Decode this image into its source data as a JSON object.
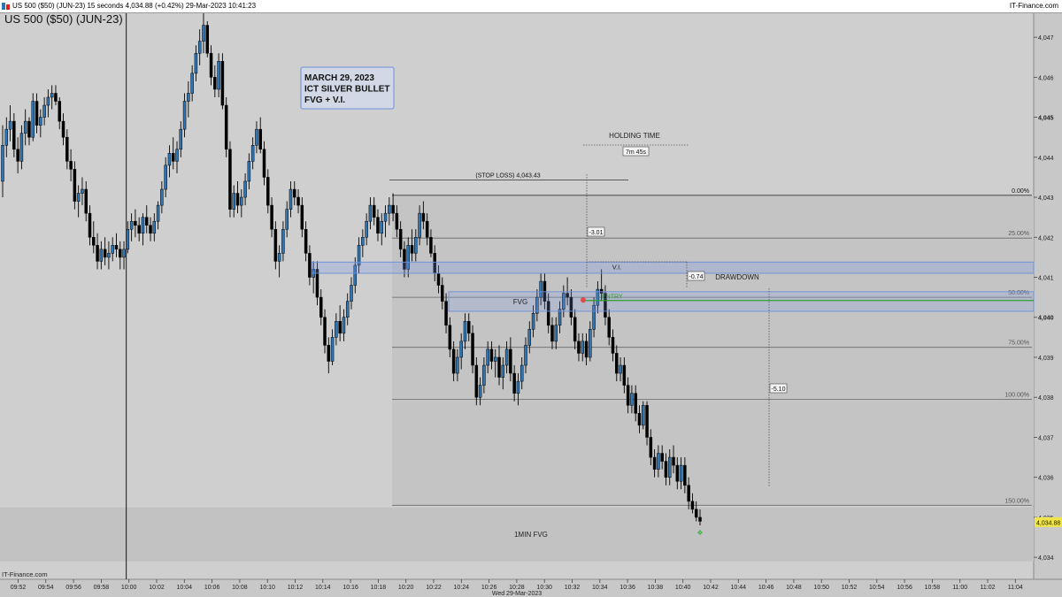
{
  "window": {
    "title": "US 500 ($50) (JUN-23) 15 seconds 4,034.88 (+0.42%) 29-Mar-2023 10:41:23",
    "brand": "IT-Finance.com"
  },
  "chart_data": {
    "type": "candlestick",
    "title": "US 500 ($50) (JUN-23)",
    "watermark": "IT-Finance.com",
    "date_label": "Wed 29-Mar-2023",
    "current_price": 4034.88,
    "current_price_label": "4,034.88",
    "colors": {
      "up": "#2e75b6",
      "down": "#000000",
      "box": "#6b8fd6",
      "entry": "#2e9e2e"
    },
    "ylim": [
      4033.45,
      4047.6
    ],
    "x_ticks": [
      "09:52",
      "09:54",
      "09:56",
      "09:58",
      "10:00",
      "10:02",
      "10:04",
      "10:06",
      "10:08",
      "10:10",
      "10:12",
      "10:14",
      "10:16",
      "10:18",
      "10:20",
      "10:22",
      "10:24",
      "10:26",
      "10:28",
      "10:30",
      "10:32",
      "10:34",
      "10:36",
      "10:38",
      "10:40",
      "10:42",
      "10:44",
      "10:46",
      "10:48",
      "10:50",
      "10:52",
      "10:54",
      "10:56",
      "10:58",
      "11:00",
      "11:02",
      "11:04"
    ],
    "y_ticks": [
      {
        "value": 4047,
        "label": "4,047"
      },
      {
        "value": 4046,
        "label": "4,046"
      },
      {
        "value": 4045,
        "label": "4,045",
        "bold": true
      },
      {
        "value": 4044,
        "label": "4,044"
      },
      {
        "value": 4043,
        "label": "4,043"
      },
      {
        "value": 4042,
        "label": "4,042"
      },
      {
        "value": 4041,
        "label": "4,041"
      },
      {
        "value": 4040,
        "label": "4,040",
        "bold": true
      },
      {
        "value": 4039,
        "label": "4,039"
      },
      {
        "value": 4038,
        "label": "4,038"
      },
      {
        "value": 4037,
        "label": "4,037"
      },
      {
        "value": 4036,
        "label": "4,036"
      },
      {
        "value": 4035,
        "label": "4,035"
      },
      {
        "value": 4034,
        "label": "4,034"
      }
    ],
    "vertical_marker_time": "10:00",
    "note": {
      "lines": [
        "MARCH 29, 2023",
        "ICT SILVER BULLET",
        "FVG + V.I."
      ]
    },
    "stop_loss": {
      "label": "(STOP LOSS) 4,043.43",
      "price": 4043.43
    },
    "fib": {
      "start_time": "10:19",
      "levels": [
        {
          "label": "0.00%",
          "price": 4043.05
        },
        {
          "label": "25.00%",
          "price": 4041.98
        },
        {
          "label": "50.00%",
          "price": 4040.5
        },
        {
          "label": "75.00%",
          "price": 4039.25
        },
        {
          "label": "100.00%",
          "price": 4037.95
        },
        {
          "label": "150.00%",
          "price": 4035.3
        }
      ]
    },
    "zones": [
      {
        "label": "V.I.",
        "top": 4041.38,
        "bottom": 4041.1
      },
      {
        "label": "FVG",
        "top": 4040.64,
        "bottom": 4040.15
      },
      {
        "label": "1MIN FVG",
        "top": 4035.25,
        "bottom": 4033.9
      }
    ],
    "entry": {
      "label": "ENTRY",
      "price": 4040.42
    },
    "holding_time": {
      "title": "HOLDING TIME",
      "value": "7m 45s"
    },
    "drawdown": {
      "label": "DRAWDOWN"
    },
    "measures": [
      {
        "label": "-3.01"
      },
      {
        "label": "-0.74"
      },
      {
        "label": "-5.10"
      }
    ]
  }
}
